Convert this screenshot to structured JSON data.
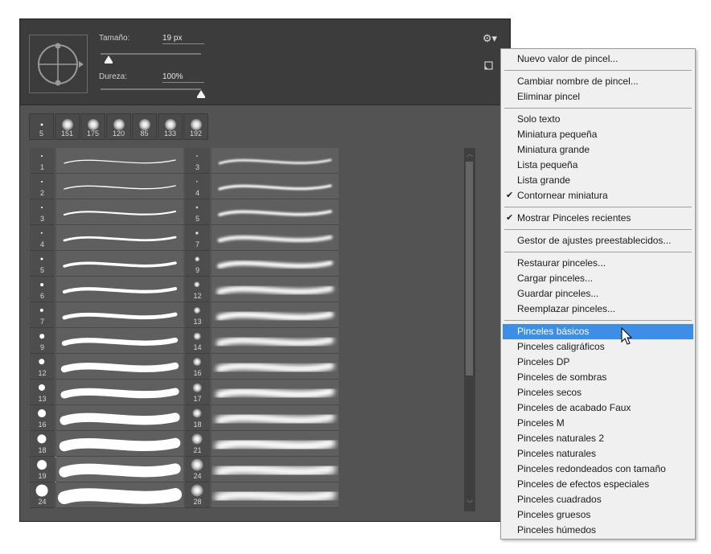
{
  "controls": {
    "size_label": "Tamaño:",
    "size_value": "19 px",
    "size_level": 0.08,
    "hardness_label": "Dureza:",
    "hardness_value": "100%",
    "hardness_level": 1.0
  },
  "icons": {
    "settings": "gear-icon",
    "new_preset": "new-preset-icon",
    "preview": "brush-tip-preview-icon",
    "check": "checkmark-icon",
    "cursor": "mouse-pointer-icon"
  },
  "recent_brushes": [
    {
      "size": "5"
    },
    {
      "size": "151"
    },
    {
      "size": "175"
    },
    {
      "size": "120"
    },
    {
      "size": "85"
    },
    {
      "size": "133"
    },
    {
      "size": "192"
    }
  ],
  "brush_columns": [
    {
      "sizes": [
        "1",
        "2",
        "3",
        "4",
        "5",
        "6",
        "7",
        "9",
        "12",
        "13",
        "16",
        "18",
        "19",
        "24"
      ]
    },
    {
      "sizes": [
        "3",
        "4",
        "5",
        "7",
        "9",
        "12",
        "13",
        "14",
        "16",
        "17",
        "18",
        "21",
        "24",
        "28"
      ]
    }
  ],
  "selected_brush": "19",
  "menu": {
    "groups": [
      {
        "items": [
          {
            "label": "Nuevo valor de pincel...",
            "checked": false
          }
        ]
      },
      {
        "items": [
          {
            "label": "Cambiar nombre de pincel...",
            "checked": false
          },
          {
            "label": "Eliminar pincel",
            "checked": false
          }
        ]
      },
      {
        "items": [
          {
            "label": "Solo texto",
            "checked": false
          },
          {
            "label": "Miniatura pequeña",
            "checked": false
          },
          {
            "label": "Miniatura grande",
            "checked": false
          },
          {
            "label": "Lista pequeña",
            "checked": false
          },
          {
            "label": "Lista grande",
            "checked": false
          },
          {
            "label": "Contornear miniatura",
            "checked": true
          }
        ]
      },
      {
        "items": [
          {
            "label": "Mostrar Pinceles recientes",
            "checked": true
          }
        ]
      },
      {
        "items": [
          {
            "label": "Gestor de ajustes preestablecidos...",
            "checked": false
          }
        ]
      },
      {
        "items": [
          {
            "label": "Restaurar pinceles...",
            "checked": false
          },
          {
            "label": "Cargar pinceles...",
            "checked": false
          },
          {
            "label": "Guardar pinceles...",
            "checked": false
          },
          {
            "label": "Reemplazar pinceles...",
            "checked": false
          }
        ]
      },
      {
        "items": [
          {
            "label": "Pinceles básicos",
            "checked": false,
            "highlighted": true
          },
          {
            "label": "Pinceles caligráficos",
            "checked": false
          },
          {
            "label": "Pinceles DP",
            "checked": false
          },
          {
            "label": "Pinceles de sombras",
            "checked": false
          },
          {
            "label": "Pinceles secos",
            "checked": false
          },
          {
            "label": "Pinceles de acabado Faux",
            "checked": false
          },
          {
            "label": "Pinceles M",
            "checked": false
          },
          {
            "label": "Pinceles naturales 2",
            "checked": false
          },
          {
            "label": "Pinceles naturales",
            "checked": false
          },
          {
            "label": "Pinceles redondeados con tamaño",
            "checked": false
          },
          {
            "label": "Pinceles de efectos especiales",
            "checked": false
          },
          {
            "label": "Pinceles cuadrados",
            "checked": false
          },
          {
            "label": "Pinceles gruesos",
            "checked": false
          },
          {
            "label": "Pinceles húmedos",
            "checked": false
          }
        ]
      }
    ]
  }
}
